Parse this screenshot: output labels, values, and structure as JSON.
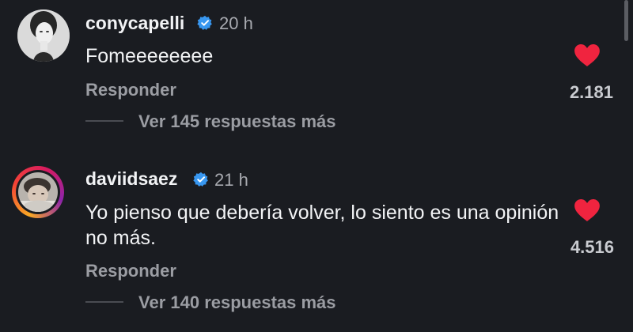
{
  "comments": [
    {
      "username": "conycapelli",
      "time": "20 h",
      "text": "Fomeeeeeeee",
      "reply_label": "Responder",
      "likes": "2.181",
      "more_replies": "Ver 145 respuestas más"
    },
    {
      "username": "daviidsaez",
      "time": "21 h",
      "text": "Yo pienso que debería volver, lo siento es una opinión no más.",
      "reply_label": "Responder",
      "likes": "4.516",
      "more_replies": "Ver 140 respuestas más"
    }
  ],
  "colors": {
    "background": "#1a1c21",
    "heart": "#f0243f",
    "verified": "#3897f0",
    "muted_text": "#9b9da3"
  },
  "icons": {
    "verified": "verified-badge-icon",
    "like": "heart-icon"
  }
}
